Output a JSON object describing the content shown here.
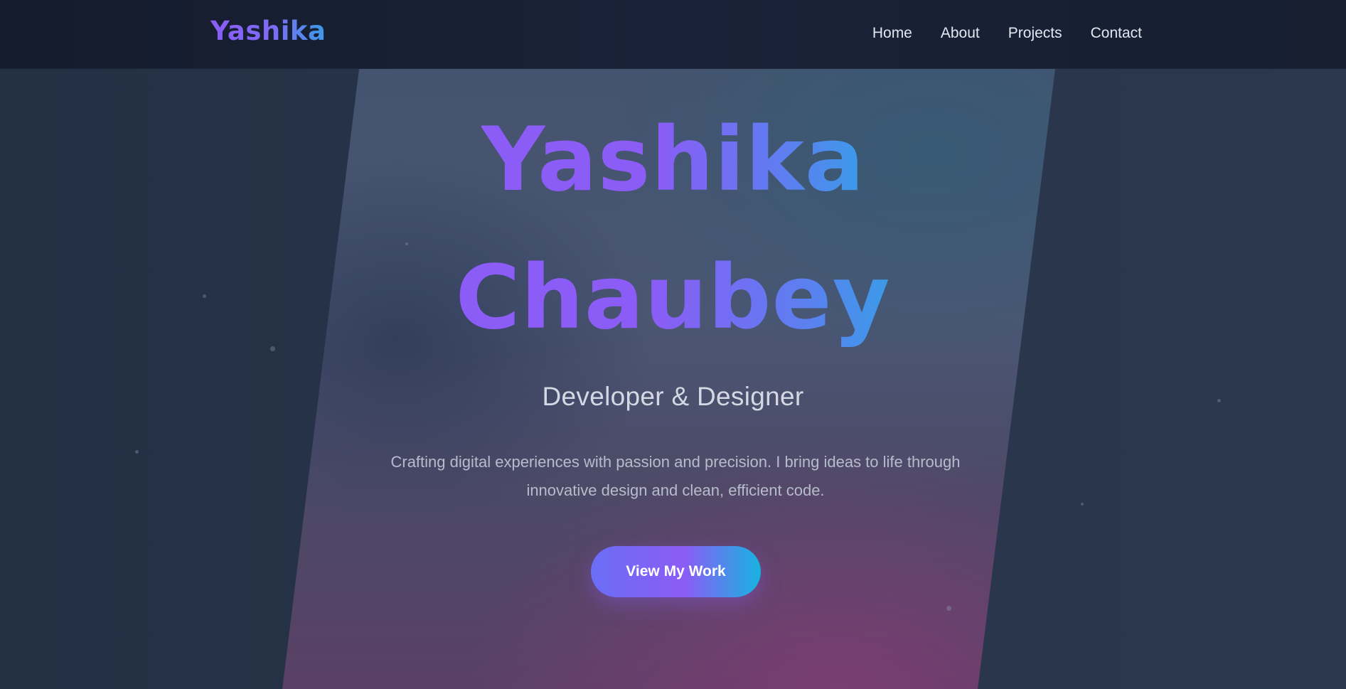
{
  "navbar": {
    "logo": "Yashika",
    "links": [
      "Home",
      "About",
      "Projects",
      "Contact"
    ]
  },
  "hero": {
    "title_line1": "Yashika",
    "title_line2": "Chaubey",
    "subtitle": "Developer & Designer",
    "description": "Crafting digital experiences with passion and precision. I bring ideas to life through innovative design and clean, efficient code.",
    "cta_label": "View My Work"
  },
  "colors": {
    "accent_purple": "#8b5cf6",
    "accent_blue": "#3b9be8",
    "accent_cyan": "#17b3e0",
    "navbar_bg": "#172033",
    "page_bg": "#243044"
  }
}
